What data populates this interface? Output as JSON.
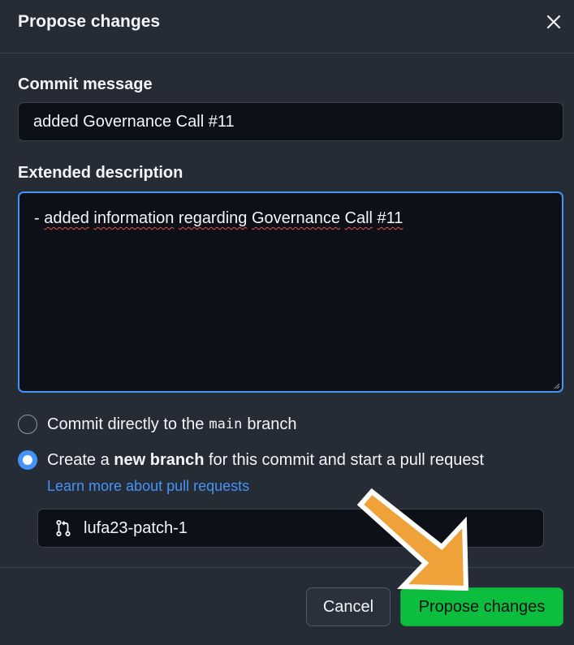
{
  "dialog": {
    "title": "Propose changes",
    "close_icon": "close-icon"
  },
  "commit": {
    "label": "Commit message",
    "value": "added Governance Call #11"
  },
  "description": {
    "label": "Extended description",
    "value_prefix": "- ",
    "value_words": [
      "added",
      "information",
      "regarding",
      "Governance",
      "Call",
      "#11"
    ]
  },
  "options": {
    "direct": {
      "prefix": "Commit directly to the",
      "branch": "main",
      "suffix": "branch",
      "checked": false
    },
    "new_branch": {
      "prefix": "Create a",
      "bold": "new branch",
      "suffix": "for this commit and start a pull request",
      "checked": true
    },
    "learn_more": "Learn more about pull requests"
  },
  "branch": {
    "icon": "git-pull-request-icon",
    "value": "lufa23-patch-1"
  },
  "footer": {
    "cancel_label": "Cancel",
    "propose_label": "Propose changes"
  },
  "colors": {
    "background": "#262c36",
    "input_bg": "#0d1117",
    "accent": "#4493f8",
    "primary_button": "#0dbd3d",
    "annotation_arrow": "#f0a23a"
  }
}
